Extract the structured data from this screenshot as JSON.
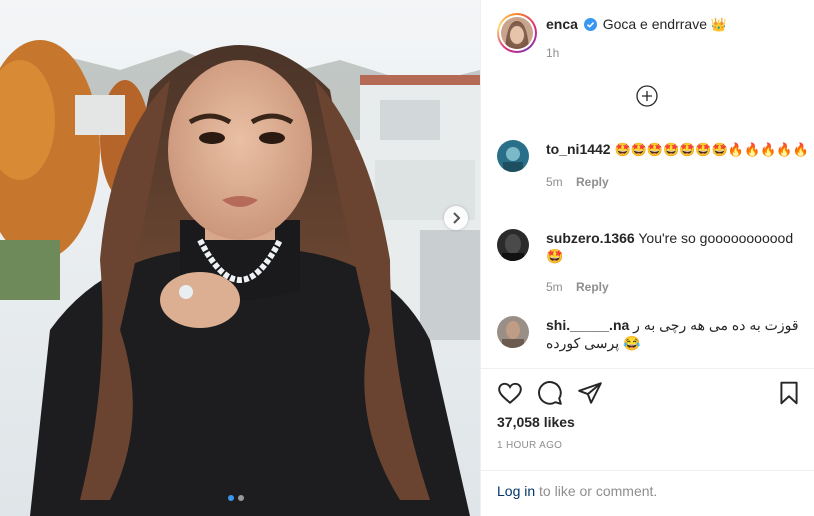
{
  "post": {
    "username": "enca",
    "caption": "Goca e endrrave",
    "caption_emoji": "👑",
    "caption_time": "1h"
  },
  "comments": [
    {
      "username": "to_ni1442",
      "text": "🤩🤩🤩🤩🤩🤩🤩🔥🔥🔥🔥🔥",
      "time": "5m",
      "reply": "Reply",
      "avatar_color": "#2a6f8a"
    },
    {
      "username": "subzero.1366",
      "text": "You're so gooooooooood 🤩",
      "time": "5m",
      "reply": "Reply",
      "avatar_color": "#2b2b2b"
    },
    {
      "username": "shi._____.na",
      "text": "قوزت به ده می هه رچی به ر پرسی کورده 😂",
      "avatar_color": "#6b5a4e"
    }
  ],
  "actions": {
    "likes": "37,058 likes",
    "time_ago": "1 HOUR AGO"
  },
  "login": {
    "link": "Log in",
    "text": " to like or comment."
  },
  "carousel": {
    "current": 1,
    "total": 2
  },
  "colors": {
    "accent": "#3897f0",
    "link": "#00376b",
    "muted": "#8e8e8e",
    "verified": "#3897f0"
  }
}
